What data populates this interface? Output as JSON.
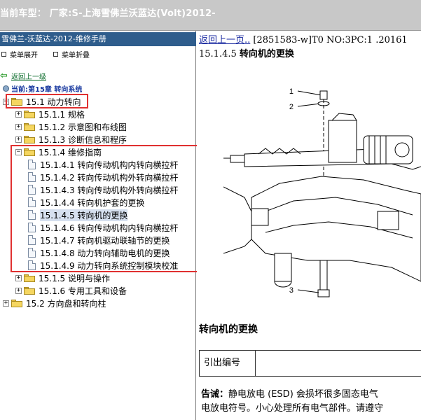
{
  "window": {
    "title": "当前车型：  厂家:S-上海雪佛兰沃蓝达(Volt)2012-"
  },
  "left_panel": {
    "header": "雪佛兰-沃蓝达-2012-维修手册",
    "toolbar": {
      "expand_label": "菜单展开",
      "collapse_label": "菜单折叠"
    },
    "back_link": "返回上一级",
    "current": "当前:第15章 转向系统",
    "tree": [
      {
        "text": "15.1 动力转向",
        "type": "folder",
        "expander": "−",
        "level": 0
      },
      {
        "text": "15.1.1 规格",
        "type": "folder",
        "expander": "+",
        "level": 1
      },
      {
        "text": "15.1.2 示意图和布线图",
        "type": "folder",
        "expander": "+",
        "level": 1
      },
      {
        "text": "15.1.3 诊断信息和程序",
        "type": "folder",
        "expander": "+",
        "level": 1
      },
      {
        "text": "15.1.4 维修指南",
        "type": "folder",
        "expander": "−",
        "level": 1
      },
      {
        "text": "15.1.4.1 转向传动机构内转向横拉杆",
        "type": "doc",
        "level": 2
      },
      {
        "text": "15.1.4.2 转向传动机构外转向横拉杆",
        "type": "doc",
        "level": 2
      },
      {
        "text": "15.1.4.3 转向传动机构外转向横拉杆",
        "type": "doc",
        "level": 2
      },
      {
        "text": "15.1.4.4 转向机护套的更换",
        "type": "doc",
        "level": 2
      },
      {
        "text": "15.1.4.5 转向机的更换",
        "type": "doc",
        "level": 2,
        "selected": true
      },
      {
        "text": "15.1.4.6 转向传动机构内转向横拉杆",
        "type": "doc",
        "level": 2
      },
      {
        "text": "15.1.4.7 转向机驱动联轴节的更换",
        "type": "doc",
        "level": 2
      },
      {
        "text": "15.1.4.8 动力转向辅助电机的更换",
        "type": "doc",
        "level": 2
      },
      {
        "text": "15.1.4.9 动力转向系统控制模块校准",
        "type": "doc",
        "level": 2
      },
      {
        "text": "15.1.5 说明与操作",
        "type": "folder",
        "expander": "+",
        "level": 1
      },
      {
        "text": "15.1.6 专用工具和设备",
        "type": "folder",
        "expander": "+",
        "level": 1
      },
      {
        "text": "15.2 方向盘和转向柱",
        "type": "folder",
        "expander": "+",
        "level": 0
      }
    ]
  },
  "content": {
    "back_link": "返回上一页..",
    "header_rest": " [2851583-w]T0 NO:3PC:1 .20161",
    "section_number": "15.1.4.5",
    "section_title": "转向机的更换",
    "callouts": [
      "1",
      "2",
      "3"
    ],
    "subheading": "转向机的更换",
    "table_header": "引出编号",
    "caution_label": "告诫：",
    "caution_line1": "静电放电 (ESD) 会损坏很多固态电气",
    "caution_line2": "电放电符号。小心处理所有电气部件。请遵守"
  },
  "colors": {
    "left_header_bg": "#2f5d8c",
    "highlight_box": "#e03030",
    "link": "#1a2aa0"
  }
}
